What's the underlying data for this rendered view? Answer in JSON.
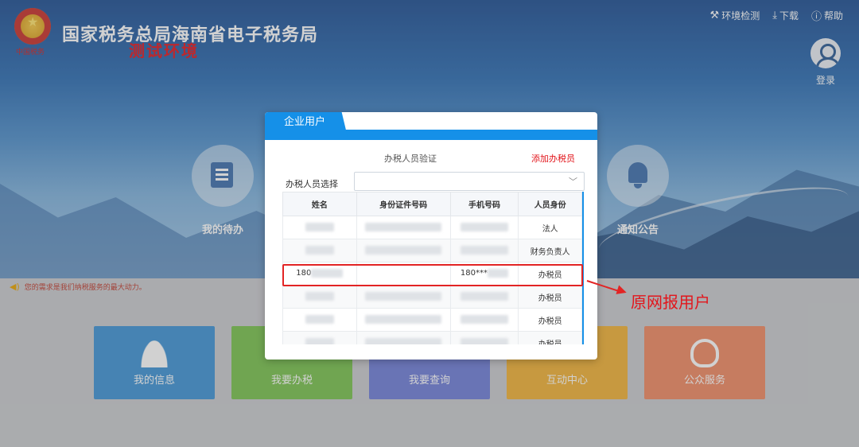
{
  "header": {
    "site_title": "国家税务总局海南省电子税务局",
    "env_label": "测试环境",
    "emblem_caption": "中国税务"
  },
  "top_links": [
    {
      "icon": "wrench-icon",
      "glyph": "⚒",
      "label": "环境检测"
    },
    {
      "icon": "download-icon",
      "glyph": "⤓",
      "label": "下载"
    },
    {
      "icon": "help-icon",
      "glyph": "ⓘ",
      "label": "帮助"
    }
  ],
  "login": {
    "label": "登录"
  },
  "quick_entries": [
    {
      "label": "我的待办",
      "icon": "todo-document-icon"
    },
    {
      "label": "通知公告",
      "icon": "bell-icon"
    }
  ],
  "notice": {
    "text": "您的需求是我们纳税服务的最大动力。"
  },
  "tiles": [
    {
      "label": "我的信息",
      "color": "#3f94d6"
    },
    {
      "label": "我要办税",
      "color": "#79c24e"
    },
    {
      "label": "我要查询",
      "color": "#6f7fd8"
    },
    {
      "label": "互动中心",
      "color": "#f2b236"
    },
    {
      "label": "公众服务",
      "color": "#f08a63"
    }
  ],
  "modal": {
    "tab_label": "企业用户",
    "title": "办税人员验证",
    "add_link": "添加办税员",
    "select_label": "办税人员选择",
    "select_value": "",
    "columns": [
      "姓名",
      "身份证件号码",
      "手机号码",
      "人员身份"
    ],
    "rows": [
      {
        "name": "",
        "id": "",
        "phone": "",
        "role": "法人"
      },
      {
        "name": "",
        "id": "",
        "phone": "",
        "role": "财务负责人"
      },
      {
        "name": "180",
        "id": "",
        "phone": "180***",
        "role": "办税员"
      },
      {
        "name": "",
        "id": "",
        "phone": "",
        "role": "办税员"
      },
      {
        "name": "",
        "id": "",
        "phone": "",
        "role": "办税员"
      },
      {
        "name": "",
        "id": "",
        "phone": "",
        "role": "办税员"
      }
    ]
  },
  "annotation": {
    "text": "原网报用户"
  },
  "colors": {
    "accent": "#1590e8",
    "alert": "#e2161c"
  }
}
